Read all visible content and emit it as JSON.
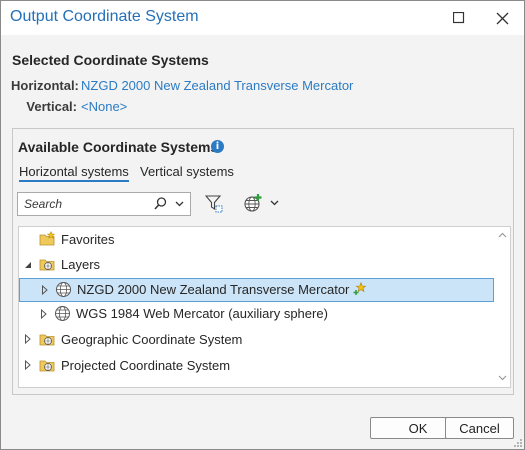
{
  "window": {
    "title": "Output Coordinate System"
  },
  "selected": {
    "heading": "Selected Coordinate Systems",
    "horizontal_label": "Horizontal:",
    "horizontal_value": "NZGD 2000 New Zealand Transverse Mercator",
    "vertical_label": "Vertical:",
    "vertical_value": "<None>"
  },
  "available": {
    "heading": "Available Coordinate Systems",
    "tabs": [
      {
        "label": "Horizontal systems",
        "active": true
      },
      {
        "label": "Vertical systems",
        "active": false
      }
    ],
    "search": {
      "placeholder": "Search",
      "value": ""
    },
    "tree": [
      {
        "label": "Favorites",
        "icon": "folder-star-icon",
        "expander": "none"
      },
      {
        "label": "Layers",
        "icon": "folder-globe-icon",
        "expander": "expanded"
      },
      {
        "label": "NZGD 2000 New Zealand Transverse Mercator",
        "icon": "globe-icon",
        "expander": "collapsed",
        "selected": true,
        "favorite_icon": "add-favorite-star-icon"
      },
      {
        "label": "WGS 1984 Web Mercator (auxiliary sphere)",
        "icon": "globe-icon",
        "expander": "collapsed"
      },
      {
        "label": "Geographic Coordinate System",
        "icon": "folder-globe-icon",
        "expander": "collapsed"
      },
      {
        "label": "Projected Coordinate System",
        "icon": "folder-globe-icon",
        "expander": "collapsed"
      }
    ]
  },
  "buttons": {
    "ok": "OK",
    "cancel": "Cancel"
  },
  "colors": {
    "accent": "#2b7bc4",
    "title": "#2470b8",
    "selection": "#cce4f7"
  }
}
